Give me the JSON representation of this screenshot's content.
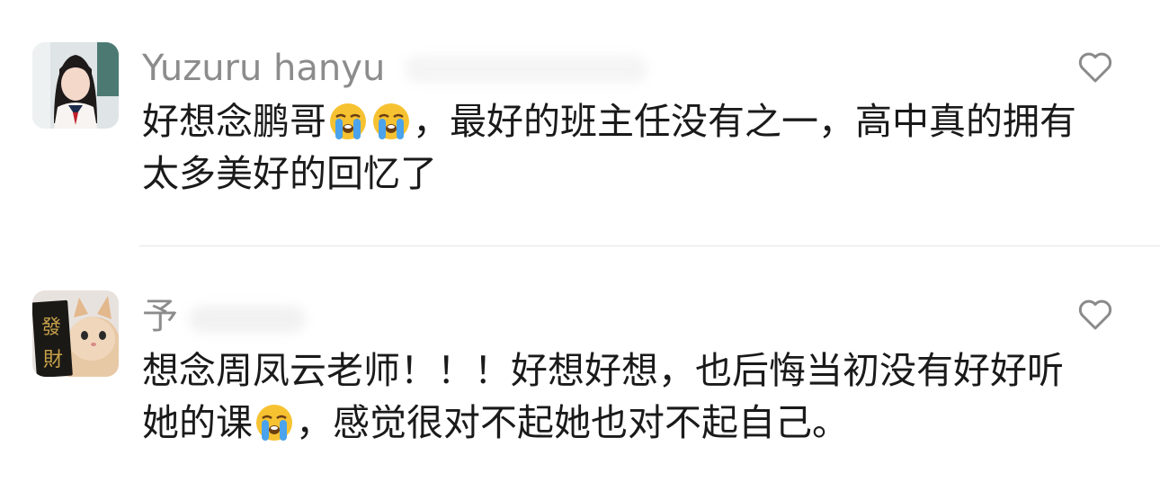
{
  "comments": [
    {
      "username": "Yuzuru hanyu",
      "text_parts": [
        "好想念鹏哥",
        "，最好的班主任没有之一，高中真的拥有太多美好的回忆了"
      ],
      "emoji": [
        "loudly-crying-face",
        "loudly-crying-face"
      ]
    },
    {
      "username": "予",
      "text_parts": [
        "想念周凤云老师！！！好想好想，也后悔当初没有好好听她的课",
        "，感觉很对不起她也对不起自己。"
      ],
      "emoji": [
        "loudly-crying-face"
      ]
    }
  ],
  "icons": {
    "like": "heart-outline-icon"
  },
  "colors": {
    "username": "#8c8c8c",
    "text": "#1a1a1a",
    "divider": "#e6e6e6",
    "emoji_face": "#f7c231"
  }
}
